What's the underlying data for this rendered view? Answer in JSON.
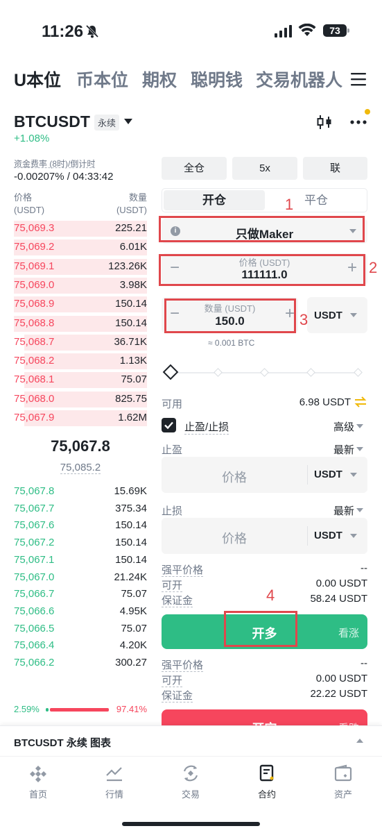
{
  "status_bar": {
    "time": "11:26",
    "battery": "73"
  },
  "top_tabs": [
    {
      "label": "U本位",
      "active": true
    },
    {
      "label": "币本位"
    },
    {
      "label": "期权"
    },
    {
      "label": "聪明钱"
    },
    {
      "label": "交易机器人"
    }
  ],
  "header": {
    "symbol": "BTCUSDT",
    "contract_type": "永续",
    "change": "+1.08%"
  },
  "funding": {
    "label": "资金费率 (8时)/倒计时",
    "value": "-0.00207% / 04:33:42"
  },
  "orderbook": {
    "price_header": "价格",
    "price_unit": "(USDT)",
    "qty_header": "数量",
    "qty_unit": "(USDT)",
    "asks": [
      {
        "price": "75,069.3",
        "qty": "225.21",
        "depth": 1.0
      },
      {
        "price": "75,069.2",
        "qty": "6.01K",
        "depth": 1.0
      },
      {
        "price": "75,069.1",
        "qty": "123.26K",
        "depth": 1.0
      },
      {
        "price": "75,069.0",
        "qty": "3.98K",
        "depth": 1.0
      },
      {
        "price": "75,068.9",
        "qty": "150.14",
        "depth": 1.0
      },
      {
        "price": "75,068.8",
        "qty": "150.14",
        "depth": 1.0
      },
      {
        "price": "75,068.7",
        "qty": "36.71K",
        "depth": 0.92
      },
      {
        "price": "75,068.2",
        "qty": "1.13K",
        "depth": 0.92
      },
      {
        "price": "75,068.1",
        "qty": "75.07",
        "depth": 0.92
      },
      {
        "price": "75,068.0",
        "qty": "825.75",
        "depth": 0.92
      },
      {
        "price": "75,067.9",
        "qty": "1.62M",
        "depth": 0.92
      }
    ],
    "last_price": "75,067.8",
    "mark_price": "75,085.2",
    "bids": [
      {
        "price": "75,067.8",
        "qty": "15.69K"
      },
      {
        "price": "75,067.7",
        "qty": "375.34"
      },
      {
        "price": "75,067.6",
        "qty": "150.14"
      },
      {
        "price": "75,067.2",
        "qty": "150.14"
      },
      {
        "price": "75,067.1",
        "qty": "150.14"
      },
      {
        "price": "75,067.0",
        "qty": "21.24K"
      },
      {
        "price": "75,066.7",
        "qty": "75.07"
      },
      {
        "price": "75,066.6",
        "qty": "4.95K"
      },
      {
        "price": "75,066.5",
        "qty": "75.07"
      },
      {
        "price": "75,066.4",
        "qty": "4.20K"
      },
      {
        "price": "75,066.2",
        "qty": "300.27"
      }
    ],
    "bid_ratio": "2.59%",
    "ask_ratio": "97.41%"
  },
  "order_panel": {
    "margin_mode": "全仓",
    "leverage": "5x",
    "position_mode": "联",
    "tab_open": "开仓",
    "tab_close": "平仓",
    "order_type": "只做Maker",
    "price_label": "价格 (USDT)",
    "price_value": "111111.0",
    "qty_label": "数量 (USDT)",
    "qty_value": "150.0",
    "qty_unit": "USDT",
    "approx": "≈ 0.001 BTC",
    "available_label": "可用",
    "available_value": "6.98 USDT",
    "tpsl_label": "止盈/止损",
    "advanced": "高级",
    "tp_label": "止盈",
    "tp_trigger": "最新",
    "tp_placeholder": "价格",
    "tp_unit": "USDT",
    "sl_label": "止损",
    "sl_trigger": "最新",
    "sl_placeholder": "价格",
    "sl_unit": "USDT",
    "long": {
      "liq_label": "强平价格",
      "liq_value": "--",
      "open_label": "可开",
      "open_value": "0.00 USDT",
      "margin_label": "保证金",
      "margin_value": "58.24 USDT",
      "button": "开多",
      "button_sub": "看涨"
    },
    "short": {
      "liq_label": "强平价格",
      "liq_value": "--",
      "open_label": "可开",
      "open_value": "0.00 USDT",
      "margin_label": "保证金",
      "margin_value": "22.22 USDT",
      "button": "开空",
      "button_sub": "看跌"
    }
  },
  "annotations": [
    "1",
    "2",
    "3",
    "4"
  ],
  "chart_strip": {
    "title": "BTCUSDT 永续 图表"
  },
  "bottom_nav": [
    {
      "label": "首页",
      "icon": "home-icon"
    },
    {
      "label": "行情",
      "icon": "markets-icon"
    },
    {
      "label": "交易",
      "icon": "trade-icon"
    },
    {
      "label": "合约",
      "icon": "futures-icon",
      "active": true
    },
    {
      "label": "资产",
      "icon": "wallet-icon"
    }
  ],
  "colors": {
    "green": "#2ebd85",
    "red": "#f6465d",
    "accent": "#f0b90b",
    "annotation": "#e0474c"
  }
}
